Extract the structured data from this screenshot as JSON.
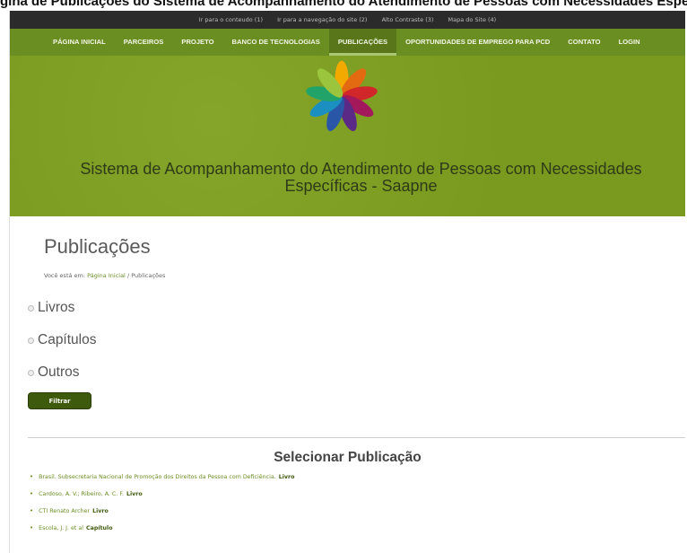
{
  "figure_caption_fragment": "gina de Publicações do Sistema de Acompanhamento do Atendimento de Pessoas com Necessidades Específicas - Saapne",
  "accessibility_bar": {
    "links": [
      "Ir para o conteudo (1)",
      "Ir para a navegação do site (2)",
      "Alto Contraste (3)",
      "Mapa do Site (4)"
    ]
  },
  "nav": {
    "items": [
      "PÁGINA INICIAL",
      "PARCEIROS",
      "PROJETO",
      "BANCO DE TECNOLOGIAS",
      "PUBLICAÇÕES",
      "OPORTUNIDADES DE EMPREGO PARA PCD",
      "CONTATO",
      "LOGIN"
    ],
    "active": "PUBLICAÇÕES"
  },
  "banner": {
    "title": "Sistema de Acompanhamento do Atendimento de Pessoas com Necessidades Específicas - Saapne",
    "logo_icon": "pinwheel-logo-icon"
  },
  "page": {
    "title": "Publicações",
    "breadcrumb": {
      "prefix": "Você está em:",
      "home": "Página Inicial",
      "separator": "/",
      "current": "Publicações"
    }
  },
  "filters": {
    "options": [
      "Livros",
      "Capítulos",
      "Outros"
    ],
    "button_label": "Filtrar"
  },
  "publications": {
    "title": "Selecionar Publicação",
    "items": [
      {
        "author": "Brasil. Subsecretaria Nacional de Promoção dos Direitos da Pessoa com Deficiência.",
        "type": "Livro"
      },
      {
        "author": "Cardoso, A. V.; Ribeiro, A. C. F.",
        "type": "Livro"
      },
      {
        "author": "CTI Renato Archer",
        "type": "Livro"
      },
      {
        "author": "Escola, J. J. et al",
        "type": "Capítulo"
      }
    ]
  },
  "colors": {
    "nav_green": "#6b8e23",
    "banner_green": "#7a9a1f",
    "button_dark_green": "#3e5a0c",
    "access_bar": "#2b2b2b"
  }
}
